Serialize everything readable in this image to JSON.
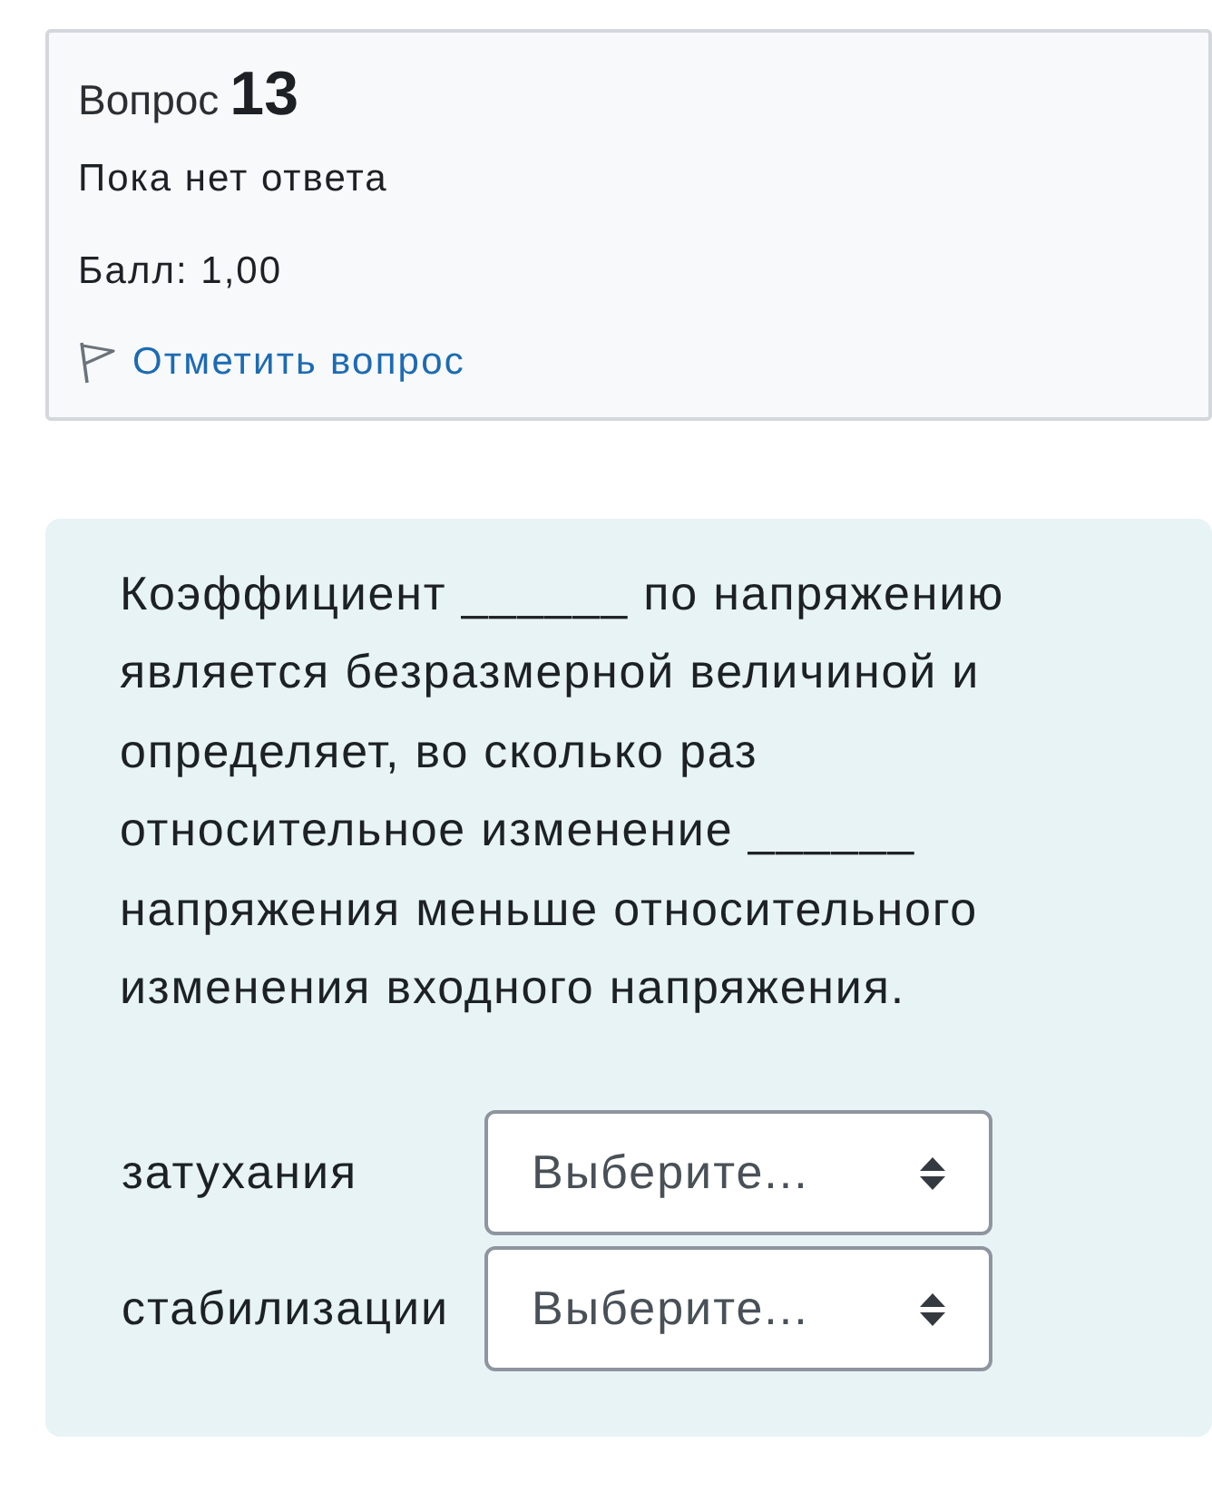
{
  "question_info": {
    "label": "Вопрос",
    "number": "13",
    "status": "Пока нет ответа",
    "grade": "Балл: 1,00",
    "flagged": false,
    "flag_link": "Отметить вопрос"
  },
  "question": {
    "text": "Коэффициент ______ по напряжению является безразмерной величиной и определяет, во сколько раз относительное изменение ______ напряжения меньше относительного изменения входного напряжения.",
    "matches": [
      {
        "stem": "затухания",
        "select": {
          "value": "Выберите..."
        }
      },
      {
        "stem": "стабилизации",
        "select": {
          "value": "Выберите..."
        }
      }
    ]
  }
}
